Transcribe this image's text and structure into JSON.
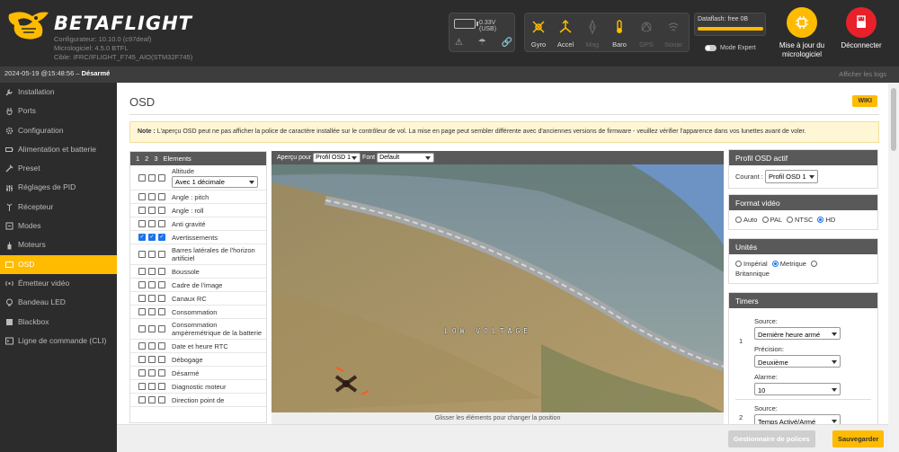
{
  "header": {
    "brand": "BETAFLIGHT",
    "configurator": "Configurateur: 10.10.0 (c97deaf)",
    "firmware": "Micrologiciel: 4.5.0 BTFL",
    "target": "Cible: IFRC/IFLIGHT_F745_AIO(STM32F745)",
    "battery_voltage": "0.33V (USB)",
    "sensors": [
      {
        "label": "Gyro",
        "icon": "gyro-icon",
        "active": true
      },
      {
        "label": "Accel",
        "icon": "accel-icon",
        "active": true
      },
      {
        "label": "Mag",
        "icon": "mag-icon",
        "active": false
      },
      {
        "label": "Baro",
        "icon": "baro-icon",
        "active": true
      },
      {
        "label": "GPS",
        "icon": "gps-icon",
        "active": false
      },
      {
        "label": "Sonar",
        "icon": "sonar-icon",
        "active": false
      }
    ],
    "dataflash": "Dataflash: free 0B",
    "expert_mode": "Mode Expert",
    "update_firmware": "Mise à jour du micrologiciel",
    "disconnect": "Déconnecter",
    "accent": "#ffbb00",
    "disconnect_color": "#e8202a"
  },
  "statusbar": {
    "datetime": "2024-05-19 @15:48:56",
    "sep": " – ",
    "state": "Désarmé",
    "show_logs": "Afficher les logs"
  },
  "sidebar": {
    "items": [
      {
        "label": "Installation",
        "icon": "wrench-icon"
      },
      {
        "label": "Ports",
        "icon": "plug-icon"
      },
      {
        "label": "Configuration",
        "icon": "gear-icon"
      },
      {
        "label": "Alimentation et batterie",
        "icon": "battery-icon"
      },
      {
        "label": "Preset",
        "icon": "preset-icon"
      },
      {
        "label": "Réglages de PID",
        "icon": "sliders-icon"
      },
      {
        "label": "Récepteur",
        "icon": "antenna-icon"
      },
      {
        "label": "Modes",
        "icon": "modes-icon"
      },
      {
        "label": "Moteurs",
        "icon": "motor-icon"
      },
      {
        "label": "OSD",
        "icon": "osd-icon",
        "active": true
      },
      {
        "label": "Émetteur vidéo",
        "icon": "transmitter-icon"
      },
      {
        "label": "Bandeau LED",
        "icon": "led-icon"
      },
      {
        "label": "Blackbox",
        "icon": "blackbox-icon"
      },
      {
        "label": "Ligne de commande (CLI)",
        "icon": "terminal-icon"
      }
    ]
  },
  "main": {
    "title": "OSD",
    "wiki": "WIKI",
    "note_label": "Note :",
    "note_text": " L'aperçu OSD peut ne pas afficher la police de caractère installée sur le contrôleur de vol. La mise en page peut sembler différente avec d'anciennes versions de firmware - veuillez vérifier l'apparence dans vos lunettes avant de voler."
  },
  "elements": {
    "tabs": [
      "1",
      "2",
      "3"
    ],
    "header": "Elements",
    "altitude_option": "Avec 1 décimale",
    "items": [
      {
        "label": "Altitude",
        "checks": [
          false,
          false,
          false
        ],
        "select": true
      },
      {
        "label": "Angle : pitch",
        "checks": [
          false,
          false,
          false
        ]
      },
      {
        "label": "Angle : roll",
        "checks": [
          false,
          false,
          false
        ]
      },
      {
        "label": "Anti gravité",
        "checks": [
          false,
          false,
          false
        ]
      },
      {
        "label": "Avertissements",
        "checks": [
          true,
          true,
          true
        ]
      },
      {
        "label": "Barres latérales de l'horizon artificiel",
        "checks": [
          false,
          false,
          false
        ]
      },
      {
        "label": "Boussole",
        "checks": [
          false,
          false,
          false
        ]
      },
      {
        "label": "Cadre de l'image",
        "checks": [
          false,
          false,
          false
        ]
      },
      {
        "label": "Canaux RC",
        "checks": [
          false,
          false,
          false
        ]
      },
      {
        "label": "Consommation",
        "checks": [
          false,
          false,
          false
        ]
      },
      {
        "label": "Consommation ampèremétrique de la batterie",
        "checks": [
          false,
          false,
          false
        ]
      },
      {
        "label": "Date et heure RTC",
        "checks": [
          false,
          false,
          false
        ]
      },
      {
        "label": "Débogage",
        "checks": [
          false,
          false,
          false
        ]
      },
      {
        "label": "Désarmé",
        "checks": [
          false,
          false,
          false
        ]
      },
      {
        "label": "Diagnostic moteur",
        "checks": [
          false,
          false,
          false
        ]
      },
      {
        "label": "Direction point de",
        "checks": [
          false,
          false,
          false
        ]
      }
    ]
  },
  "preview": {
    "for_label": "Aperçu pour",
    "profile": "Profil OSD 1",
    "font_label": "Font",
    "font": "Default",
    "osd_text": "LOW VOLTAGE",
    "footer": "Glisser les éléments pour changer la position"
  },
  "profile_panel": {
    "title": "Profil OSD actif",
    "current_label": "Courant :",
    "current": "Profil OSD 1"
  },
  "video_panel": {
    "title": "Format vidéo",
    "options": [
      "Auto",
      "PAL",
      "NTSC",
      "HD"
    ],
    "selected": "HD"
  },
  "units_panel": {
    "title": "Unités",
    "imperial": "Impérial",
    "metric": "Metrique",
    "british": "Britannique",
    "selected": "Metrique"
  },
  "timers_panel": {
    "title": "Timers",
    "timer1": {
      "num": "1",
      "source_label": "Source:",
      "source": "Dernière heure armé",
      "precision_label": "Précision:",
      "precision": "Deuxième",
      "alarm_label": "Alarme:",
      "alarm": "10"
    },
    "timer2": {
      "num": "2",
      "source_label": "Source:",
      "source": "Temps Activé/Armé"
    }
  },
  "footer": {
    "manage_fonts": "Gestionnaire de polices",
    "save": "Sauvegarder"
  }
}
